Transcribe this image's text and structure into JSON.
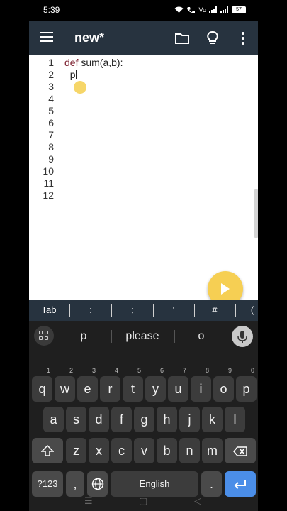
{
  "status": {
    "time": "5:39",
    "icons": [
      "wifi-icon",
      "wifi-calling-icon",
      "volte-icon",
      "signal-icon",
      "signal-icon"
    ],
    "battery": "57"
  },
  "app": {
    "title": "new*",
    "icons": [
      "menu-icon",
      "folder-icon",
      "lightbulb-icon",
      "more-vert-icon"
    ],
    "accent": "#27333f"
  },
  "editor": {
    "line_numbers": [
      "1",
      "2",
      "3",
      "4",
      "5",
      "6",
      "7",
      "8",
      "9",
      "10",
      "11",
      "12"
    ],
    "code": [
      {
        "keyword": "def",
        "rest": " sum(a,b):"
      },
      {
        "keyword": "",
        "rest": "  p"
      }
    ],
    "run_button_color": "#f6cf53"
  },
  "symbol_bar": {
    "keys": [
      "Tab",
      ":",
      ";",
      "'",
      "#",
      "("
    ]
  },
  "keyboard": {
    "suggestions": [
      "p",
      "please",
      "o"
    ],
    "row1": [
      {
        "k": "q",
        "h": "1"
      },
      {
        "k": "w",
        "h": "2"
      },
      {
        "k": "e",
        "h": "3"
      },
      {
        "k": "r",
        "h": "4"
      },
      {
        "k": "t",
        "h": "5"
      },
      {
        "k": "y",
        "h": "6"
      },
      {
        "k": "u",
        "h": "7"
      },
      {
        "k": "i",
        "h": "8"
      },
      {
        "k": "o",
        "h": "9"
      },
      {
        "k": "p",
        "h": "0"
      }
    ],
    "row2": [
      "a",
      "s",
      "d",
      "f",
      "g",
      "h",
      "j",
      "k",
      "l"
    ],
    "row3": [
      "z",
      "x",
      "c",
      "v",
      "b",
      "n",
      "m"
    ],
    "symbols_key": "?123",
    "comma_key": ",",
    "space_label": "English",
    "period_key": ".",
    "enter_color": "#4b8ee8"
  }
}
